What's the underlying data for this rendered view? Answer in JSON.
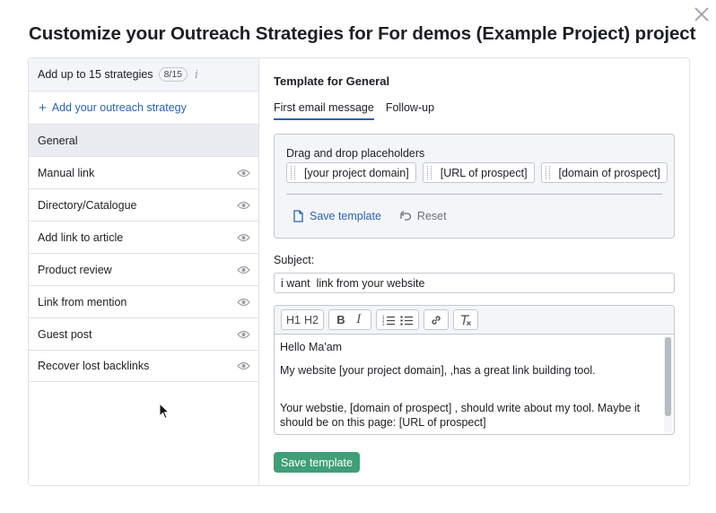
{
  "dialog": {
    "title": "Customize your Outreach Strategies for For demos (Example Project) project",
    "close_icon": "close-icon"
  },
  "sidebar": {
    "header_label": "Add up to 15 strategies",
    "counter": "8/15",
    "info_glyph": "i",
    "add_label": "Add your outreach strategy",
    "items": [
      {
        "label": "General",
        "active": true,
        "eye": false
      },
      {
        "label": "Manual link",
        "active": false,
        "eye": true
      },
      {
        "label": "Directory/Catalogue",
        "active": false,
        "eye": true
      },
      {
        "label": "Add link to article",
        "active": false,
        "eye": true
      },
      {
        "label": "Product review",
        "active": false,
        "eye": true
      },
      {
        "label": "Link from mention",
        "active": false,
        "eye": true
      },
      {
        "label": "Guest post",
        "active": false,
        "eye": true
      },
      {
        "label": "Recover lost backlinks",
        "active": false,
        "eye": true
      }
    ]
  },
  "template": {
    "title": "Template for General",
    "tabs": [
      {
        "label": "First email message",
        "active": true
      },
      {
        "label": "Follow-up",
        "active": false
      }
    ],
    "placeholders": {
      "label": "Drag and drop placeholders",
      "chips": [
        "[your project domain]",
        "[URL of prospect]",
        "[domain of prospect]"
      ],
      "save_label": "Save template",
      "reset_label": "Reset"
    },
    "subject": {
      "label": "Subject:",
      "value": "i want  link from your website"
    },
    "toolbar": {
      "h1": "H1",
      "h2": "H2",
      "bold": "B",
      "italic": "I"
    },
    "body": {
      "lines": [
        "Hello Ma'am",
        "My website [your project domain], ,has a great link building tool.",
        "Your webstie, [domain of prospect] , should write about my tool. Maybe it should be on this page: [URL of prospect]"
      ]
    },
    "save_button": "Save template"
  },
  "colors": {
    "accent": "#2a63ad",
    "primary_button": "#3f9f77",
    "panel_bg": "#f4f5f9",
    "border": "#c4c7cf"
  }
}
